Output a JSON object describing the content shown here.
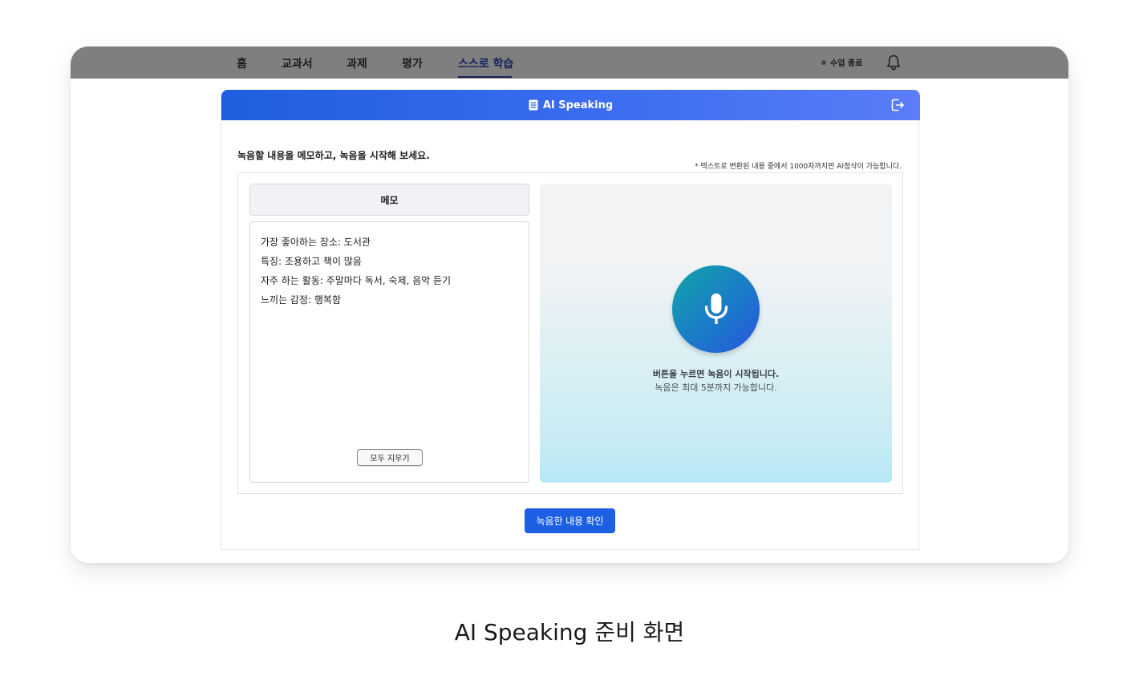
{
  "nav": {
    "items": [
      {
        "label": "홈",
        "active": false
      },
      {
        "label": "교과서",
        "active": false
      },
      {
        "label": "과제",
        "active": false
      },
      {
        "label": "평가",
        "active": false
      },
      {
        "label": "스스로 학습",
        "active": true
      }
    ],
    "end_class_label": "수업 종료",
    "bell_icon": "bell-icon"
  },
  "panel": {
    "title": "AI Speaking",
    "title_icon": "document-icon",
    "exit_icon": "exit-icon",
    "instruction": "녹음할 내용을 메모하고, 녹음을 시작해 보세요.",
    "notice": "* 텍스트로 변환된 내용 중에서 1000자까지만 AI첨삭이 가능합니다.",
    "memo": {
      "heading": "메모",
      "lines": [
        "가장 좋아하는 장소: 도서관",
        "특징: 조용하고 책이 많음",
        "자주 하는 활동: 주말마다 독서, 숙제, 음악 듣기",
        "느끼는 감정: 행복함"
      ],
      "clear_label": "모두 지우기"
    },
    "record": {
      "mic_icon": "microphone-icon",
      "message": "버튼을 누르면 녹음이 시작됩니다.",
      "sub_message": "녹음은 최대 5분까지 가능합니다."
    },
    "confirm_label": "녹음한 내용 확인"
  },
  "caption": "AI Speaking 준비 화면",
  "colors": {
    "nav_bg": "#7f7f7f",
    "header_gradient_start": "#1f5ee0",
    "header_gradient_end": "#5b7df8",
    "mic_gradient_start": "#11a5a8",
    "mic_gradient_end": "#2a55db",
    "confirm_button": "#1d5fe2"
  }
}
